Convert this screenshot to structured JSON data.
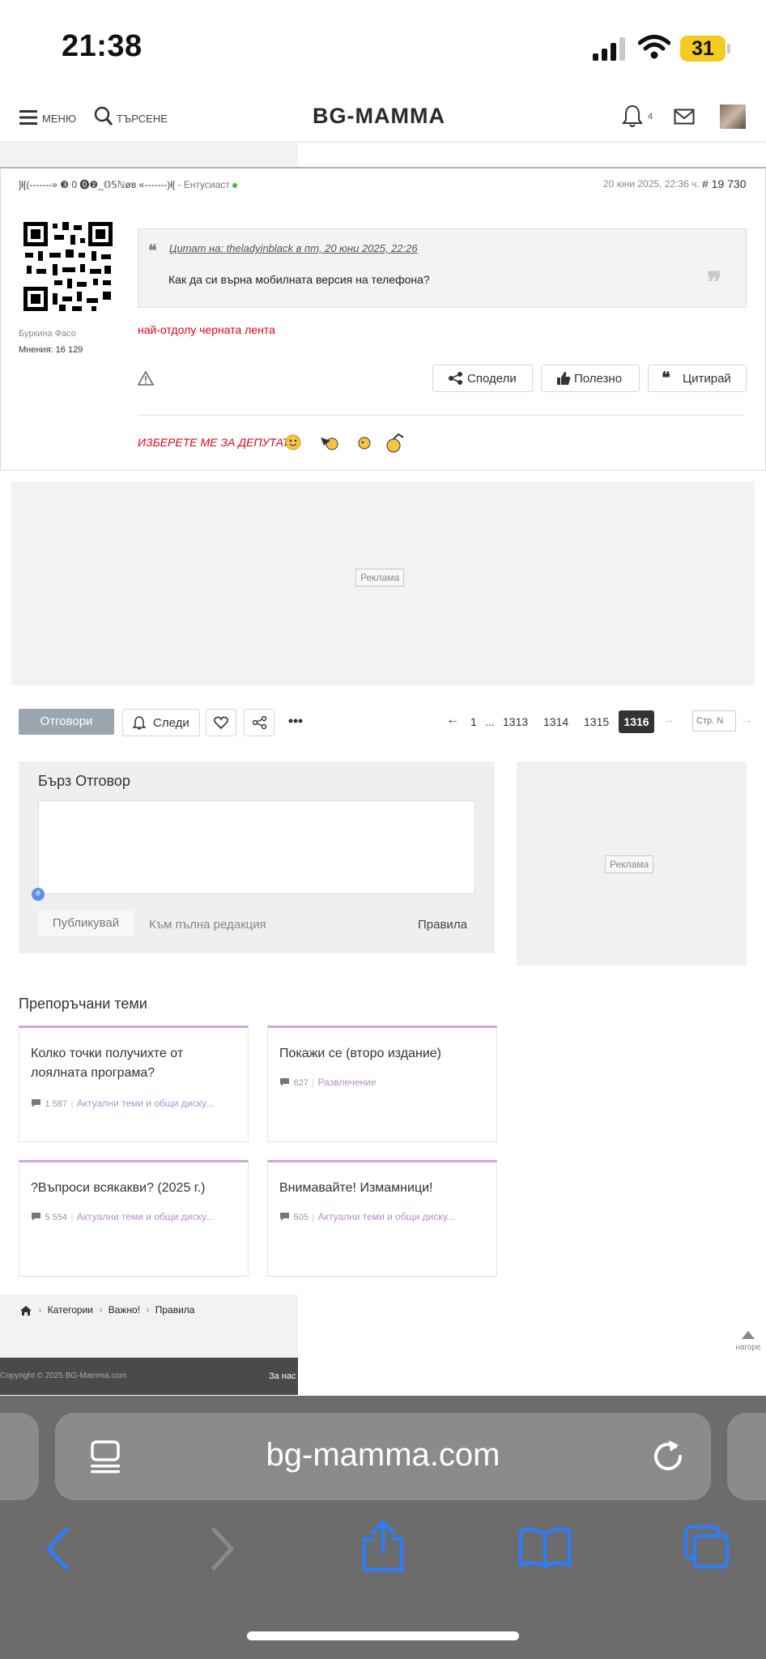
{
  "status_bar": {
    "time": "21:38",
    "battery": "31"
  },
  "header": {
    "menu_label": "МЕНЮ",
    "search_label": "ТЪРСЕНЕ",
    "logo": "BG-MAMMA",
    "notifications_count": "4"
  },
  "post": {
    "author_line": "]ł[(-------» ❸ 0 ⓿❷_𝕆𝕊ℕøв «-------)ł[",
    "author_rank": "- Ентусиаст",
    "date": "20 юни 2025, 22:36 ч.",
    "number": "# 19 730",
    "location": "Буркина Фасо",
    "opinions_label": "Мнения:",
    "opinions_count": "16 129",
    "quote_cite": "Цитат на: theladyinblack в пт, 20 юни 2025, 22:26",
    "quote_text": "Как да си върна мобилната версия на телефона?",
    "reply_text": "най-отдолу черната лента",
    "share_label": "Сподели",
    "useful_label": "Полезно",
    "quote_label": "Цитирай",
    "signature": "ИЗБЕРЕТЕ МЕ ЗА  ДЕПУТАТ."
  },
  "ads": {
    "label": "Реклама"
  },
  "toolbar": {
    "reply_label": "Отговори",
    "follow_label": "Следи"
  },
  "pagination": {
    "pages": [
      "1",
      "...",
      "1313",
      "1314",
      "1315"
    ],
    "current": "1316",
    "page_placeholder": "Стр. N"
  },
  "quick_reply": {
    "title": "Бърз Отговор",
    "publish_label": "Публикувай",
    "full_edit_label": "Към пълна редакция",
    "rules_label": "Правила"
  },
  "recommended": {
    "title": "Препоръчани теми",
    "items": [
      {
        "title": "Колко точки получихте от лоялната програма?",
        "count": "1 587",
        "category": "Актуални теми и общи диску..."
      },
      {
        "title": "Покажи се (второ издание)",
        "count": "627",
        "category": "Развлечение"
      },
      {
        "title": "?Въпроси всякакви? (2025 г.)",
        "count": "5 554",
        "category": "Актуални теми и общи диску..."
      },
      {
        "title": "Внимавайте! Измамници!",
        "count": "505",
        "category": "Актуални теми и общи диску..."
      }
    ]
  },
  "breadcrumb": {
    "items": [
      "Категории",
      "Важно!",
      "Правила"
    ]
  },
  "back_to_top": "нагоре",
  "footer": {
    "copyright": "Copyright © 2025 BG-Mamma.com",
    "about": "За нас"
  },
  "safari": {
    "url": "bg-mamma.com"
  },
  "colors": {
    "accent_purple": "#c9a8d6",
    "reply_button": "#9aa7b1",
    "signature_red": "#e4001b",
    "ios_blue": "#2f7cf6"
  }
}
